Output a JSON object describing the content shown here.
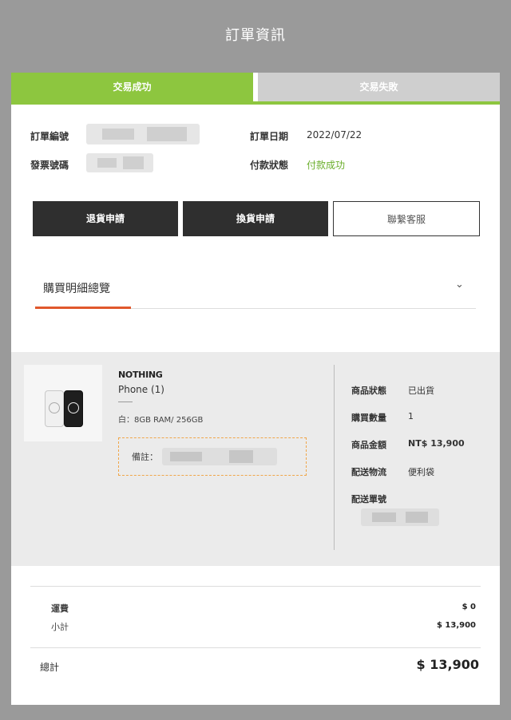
{
  "modal": {
    "title": "訂單資訊"
  },
  "tabs": [
    {
      "label": "交易成功",
      "active": true
    },
    {
      "label": "交易失敗",
      "active": false
    }
  ],
  "order": {
    "number_label": "訂單編號",
    "invoice_label": "發票號碼",
    "date_label": "訂單日期",
    "date_value": "2022/07/22",
    "payment_label": "付款狀態",
    "payment_value": "付款成功"
  },
  "actions": {
    "return_label": "退貨申請",
    "exchange_label": "換貨申請",
    "contact_label": "聯繫客服"
  },
  "summary": {
    "title": "購買明細總覽",
    "icon": "chevron-down-icon"
  },
  "product": {
    "brand": "NOTHING",
    "name": "Phone (1)",
    "variant": "白：8GB RAM/ 256GB",
    "note_label": "備註：",
    "details": [
      {
        "label": "商品狀態",
        "value": "已出貨"
      },
      {
        "label": "購買數量",
        "value": "1"
      },
      {
        "label": "商品金額",
        "value": "NT$ 13,900"
      },
      {
        "label": "配送物流",
        "value": "便利袋"
      },
      {
        "label": "配送單號",
        "value": ""
      }
    ]
  },
  "totals": {
    "shipping_label": "運費",
    "shipping_value": "$ 0",
    "subtotal_label": "小計",
    "subtotal_value": "$ 13,900",
    "total_label": "總計",
    "total_value": "$ 13,900"
  },
  "colors": {
    "accent_green": "#8dc63f",
    "accent_orange": "#e0582c",
    "dark_button": "#2f2f2f",
    "overlay": "#9a9a9a"
  }
}
